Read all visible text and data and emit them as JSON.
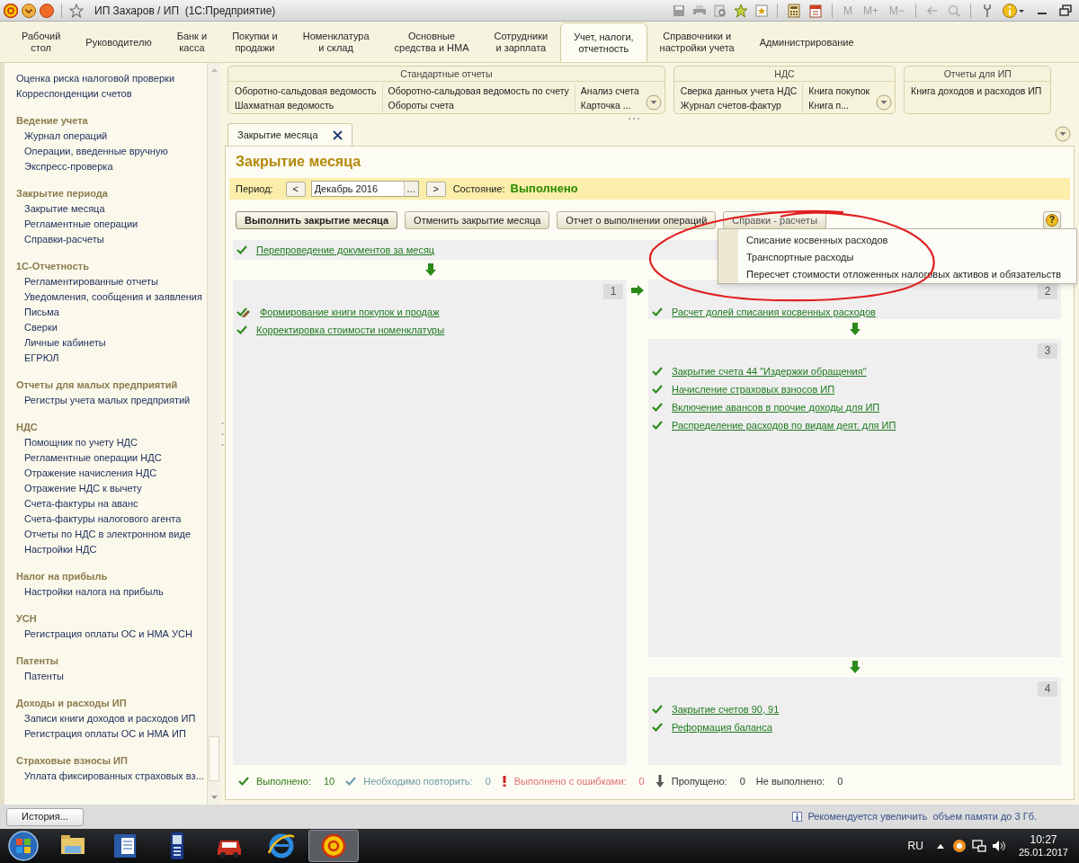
{
  "window": {
    "title": "ИП Захаров / ИП  (1С:Предприятие)",
    "memory_buttons": [
      "M",
      "M+",
      "M−"
    ]
  },
  "sections": [
    {
      "label": "Рабочий\nстол",
      "selected": false
    },
    {
      "label": "Руководителю",
      "selected": false
    },
    {
      "label": "Банк и\nкасса",
      "selected": false
    },
    {
      "label": "Покупки и\nпродажи",
      "selected": false
    },
    {
      "label": "Номенклатура\nи склад",
      "selected": false
    },
    {
      "label": "Основные\nсредства и НМА",
      "selected": false
    },
    {
      "label": "Сотрудники\nи зарплата",
      "selected": false
    },
    {
      "label": "Учет, налоги,\nотчетность",
      "selected": true
    },
    {
      "label": "Справочники и\nнастройки учета",
      "selected": false
    },
    {
      "label": "Администрирование",
      "selected": false
    }
  ],
  "sidebar": {
    "links": [
      "Оценка риска налоговой проверки",
      "Корреспонденции счетов"
    ],
    "groups": [
      {
        "title": "Ведение учета",
        "items": [
          "Журнал операций",
          "Операции, введенные вручную",
          "Экспресс-проверка"
        ]
      },
      {
        "title": "Закрытие периода",
        "items": [
          "Закрытие месяца",
          "Регламентные операции",
          "Справки-расчеты"
        ]
      },
      {
        "title": "1С-Отчетность",
        "items": [
          "Регламентированные отчеты",
          "Уведомления, сообщения и заявления",
          "Письма",
          "Сверки",
          "Личные кабинеты",
          "ЕГРЮЛ"
        ]
      },
      {
        "title": "Отчеты для малых предприятий",
        "items": [
          "Регистры учета малых предприятий"
        ]
      },
      {
        "title": "НДС",
        "items": [
          "Помощник по учету НДС",
          "Регламентные операции НДС",
          "Отражение начисления НДС",
          "Отражение НДС к вычету",
          "Счета-фактуры на аванс",
          "Счета-фактуры налогового агента",
          "Отчеты по НДС в электронном виде",
          "Настройки НДС"
        ]
      },
      {
        "title": "Налог на прибыль",
        "items": [
          "Настройки налога на прибыль"
        ]
      },
      {
        "title": "УСН",
        "items": [
          "Регистрация оплаты ОС и НМА УСН"
        ]
      },
      {
        "title": "Патенты",
        "items": [
          "Патенты"
        ]
      },
      {
        "title": "Доходы и расходы ИП",
        "items": [
          "Записи книги доходов и расходов ИП",
          "Регистрация оплаты ОС и НМА ИП"
        ]
      },
      {
        "title": "Страховые взносы ИП",
        "items": [
          "Уплата фиксированных страховых вз..."
        ]
      }
    ]
  },
  "command_panel": [
    {
      "title": "Стандартные отчеты",
      "more": true,
      "columns": [
        [
          "Оборотно-сальдовая ведомость",
          "Шахматная ведомость"
        ],
        [
          "Оборотно-сальдовая ведомость по счету",
          "Обороты счета"
        ],
        [
          "Анализ счета",
          "Карточка ..."
        ]
      ]
    },
    {
      "title": "НДС",
      "more": true,
      "columns": [
        [
          "Сверка данных учета НДС",
          "Журнал счетов-фактур"
        ],
        [
          "Книга покупок",
          "Книга п..."
        ]
      ]
    },
    {
      "title": "Отчеты для ИП",
      "more": false,
      "columns": [
        [
          "Книга доходов и расходов ИП"
        ]
      ]
    }
  ],
  "tabs": [
    {
      "label": "Закрытие месяца",
      "selected": true
    }
  ],
  "form": {
    "title": "Закрытие месяца",
    "period_label": "Период:",
    "period_value": "Декабрь 2016",
    "period_prev": "<",
    "period_next": ">",
    "period_choose": "...",
    "state_label": "Состояние:",
    "state_value": "Выполнено",
    "buttons": [
      {
        "label": "Выполнить закрытие месяца",
        "kind": "default"
      },
      {
        "label": "Отменить закрытие месяца",
        "kind": "normal"
      },
      {
        "label": "Отчет о выполнении операций",
        "kind": "normal"
      },
      {
        "label": "Справки - расчеты",
        "kind": "menu"
      }
    ],
    "help": "?",
    "menu": [
      "Списание косвенных расходов",
      "Транспортные расходы",
      "Пересчет стоимости отложенных налоговых активов и обязательств"
    ],
    "reposting": {
      "text": "Перепроведение документов за месяц",
      "done": true,
      "edited": false
    },
    "blocks": [
      {
        "number": "1",
        "items": [
          {
            "text": "Формирование книги покупок и продаж",
            "done": true,
            "edited": true
          },
          {
            "text": "Корректировка стоимости номенклатуры",
            "done": true,
            "edited": false
          }
        ]
      },
      {
        "number": "2",
        "items": [
          {
            "text": "Расчет долей списания косвенных расходов",
            "done": true,
            "edited": false
          }
        ]
      },
      {
        "number": "3",
        "items": [
          {
            "text": "Закрытие счета 44 \"Издержки обращения\"",
            "done": true,
            "edited": false
          },
          {
            "text": "Начисление страховых взносов ИП",
            "done": true,
            "edited": false
          },
          {
            "text": "Включение авансов в прочие доходы для ИП",
            "done": true,
            "edited": false
          },
          {
            "text": "Распределение расходов по видам деят. для ИП",
            "done": true,
            "edited": false
          }
        ]
      },
      {
        "number": "4",
        "items": [
          {
            "text": "Закрытие счетов 90, 91",
            "done": true,
            "edited": false
          },
          {
            "text": "Реформация баланса",
            "done": true,
            "edited": false
          }
        ]
      }
    ],
    "summary": [
      {
        "kind": "done",
        "label": "Выполнено:",
        "value": "10"
      },
      {
        "kind": "repeat",
        "label": "Необходимо повторить:",
        "value": "0"
      },
      {
        "kind": "error",
        "label": "Выполнено с ошибками:",
        "value": "0"
      },
      {
        "kind": "skipped",
        "label": "Пропущено:",
        "value": "0"
      },
      {
        "kind": "not_done",
        "label": "Не выполнено:",
        "value": "0"
      }
    ]
  },
  "history_button": "История...",
  "status_message": "Рекомендуется увеличить  объем памяти до 3 Гб.",
  "taskbar": {
    "apps": [
      {
        "kind": "folder",
        "selected": false
      },
      {
        "kind": "word",
        "selected": false
      },
      {
        "kind": "phone",
        "selected": false
      },
      {
        "kind": "car",
        "selected": false
      },
      {
        "kind": "browser",
        "selected": false
      },
      {
        "kind": "onec",
        "selected": true
      }
    ],
    "language": "RU",
    "time": "10:27",
    "date": "25.01.2017"
  }
}
